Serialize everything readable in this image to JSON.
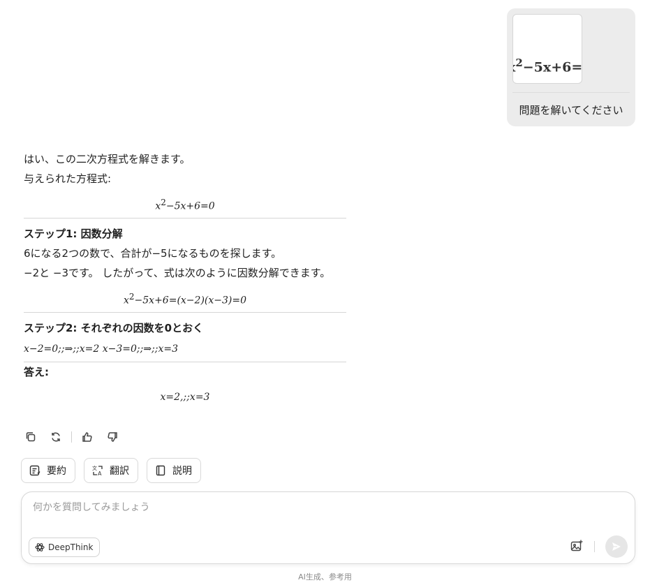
{
  "user_message": {
    "image_equation": {
      "base": "x",
      "exp": "2",
      "rest": "−5x+6="
    },
    "text": "問題を解いてください"
  },
  "answer": {
    "intro": "はい、この二次方程式を解きます。",
    "given_label": "与えられた方程式:",
    "eq1": {
      "base": "x",
      "exp": "2",
      "rest": "−5x+6=0"
    },
    "step1": {
      "title": "ステップ1:  因数分解",
      "line1": "6になる2つの数で、合計が−5になるものを探します。",
      "line2": "−2と −3です。 したがって、式は次のように因数分解できます。",
      "eq": {
        "base": "x",
        "exp": "2",
        "rest": "−5x+6=(x−2)(x−3)=0"
      }
    },
    "step2": {
      "title": "ステップ2:  それぞれの因数を0とおく",
      "line": "x−2=0;;⇒;;x=2 x−3=0;;⇒;;x=3"
    },
    "final": {
      "title": "答え:",
      "eq": "x=2,;;x=3"
    }
  },
  "actions": {
    "copy": "copy-icon",
    "regenerate": "refresh-icon",
    "like": "thumbs-up-icon",
    "dislike": "thumbs-down-icon"
  },
  "chips": [
    {
      "label": "要約",
      "icon": "summary-icon"
    },
    {
      "label": "翻訳",
      "icon": "translate-icon"
    },
    {
      "label": "説明",
      "icon": "book-icon"
    }
  ],
  "input": {
    "placeholder": "何かを質問してみましょう",
    "deepthink_label": "DeepThink"
  },
  "footer": "AI生成、参考用"
}
